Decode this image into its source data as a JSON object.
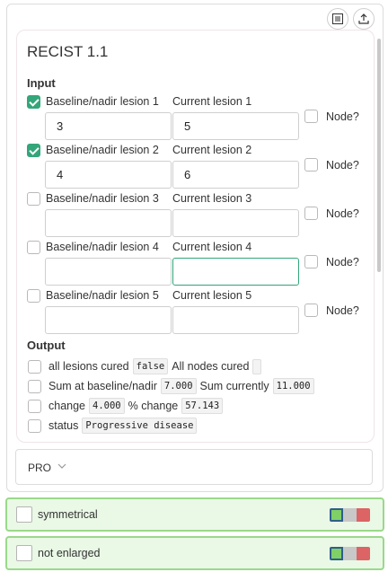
{
  "app": {
    "title": "RECIST 1.1",
    "input_heading": "Input",
    "output_heading": "Output"
  },
  "lesions": [
    {
      "baseline_label": "Baseline/nadir lesion 1",
      "current_label": "Current lesion 1",
      "baseline_value": "3",
      "current_value": "5",
      "checked": true,
      "node_label": "Node?"
    },
    {
      "baseline_label": "Baseline/nadir lesion 2",
      "current_label": "Current lesion 2",
      "baseline_value": "4",
      "current_value": "6",
      "checked": true,
      "node_label": "Node?"
    },
    {
      "baseline_label": "Baseline/nadir lesion 3",
      "current_label": "Current lesion 3",
      "baseline_value": "",
      "current_value": "",
      "checked": false,
      "node_label": "Node?"
    },
    {
      "baseline_label": "Baseline/nadir lesion 4",
      "current_label": "Current lesion 4",
      "baseline_value": "",
      "current_value": "",
      "checked": false,
      "node_label": "Node?"
    },
    {
      "baseline_label": "Baseline/nadir lesion 5",
      "current_label": "Current lesion 5",
      "baseline_value": "",
      "current_value": "",
      "checked": false,
      "node_label": "Node?"
    }
  ],
  "output": {
    "all_lesions_cured_label": "all lesions cured",
    "all_lesions_cured_value": "false",
    "all_nodes_cured_label": "All nodes cured",
    "all_nodes_cured_value": "",
    "sum_baseline_label": "Sum at baseline/nadir",
    "sum_baseline_value": "7.000",
    "sum_current_label": "Sum currently",
    "sum_current_value": "11.000",
    "change_label": "change",
    "change_value": "4.000",
    "pct_change_label": "% change",
    "pct_change_value": "57.143",
    "status_label": "status",
    "status_value": "Progressive disease"
  },
  "pro_select": {
    "label": "PRO"
  },
  "bottom_rows": [
    {
      "label": "symmetrical"
    },
    {
      "label": "not enlarged"
    }
  ],
  "colors": {
    "accent": "#33a67a",
    "green_border": "#9ad98a",
    "green_bg": "#eaf8e6",
    "red": "#dc6464"
  },
  "icons": [
    "table-settings-icon",
    "upload-icon",
    "chevron-down-icon"
  ]
}
